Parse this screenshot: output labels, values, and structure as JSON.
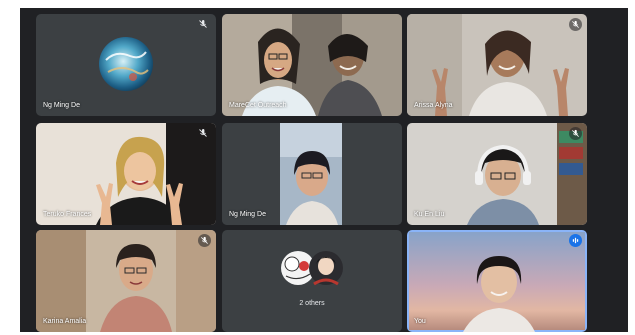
{
  "meeting": {
    "participants": [
      {
        "name": "Ng Ming De",
        "muted": true,
        "camera": false
      },
      {
        "name": "MareCet Outreach",
        "muted": false,
        "camera": true
      },
      {
        "name": "Arissa Alyna",
        "muted": true,
        "camera": true
      },
      {
        "name": "Teruko Frances",
        "muted": true,
        "camera": true
      },
      {
        "name": "Ng Ming De",
        "muted": false,
        "camera": true
      },
      {
        "name": "Ku En Liu",
        "muted": true,
        "camera": true
      },
      {
        "name": "Karina Amalia",
        "muted": true,
        "camera": true
      },
      {
        "name": "2 others",
        "muted": false,
        "camera": false
      },
      {
        "name": "You",
        "muted": false,
        "camera": true,
        "speaking": true
      }
    ]
  },
  "colors": {
    "background": "#202124",
    "tile": "#3c4043",
    "speaking_accent": "#1a73e8",
    "highlight_border": "#8ab4f8"
  },
  "icons": {
    "muted": "mic-off-icon",
    "speaking": "audio-level-icon"
  }
}
